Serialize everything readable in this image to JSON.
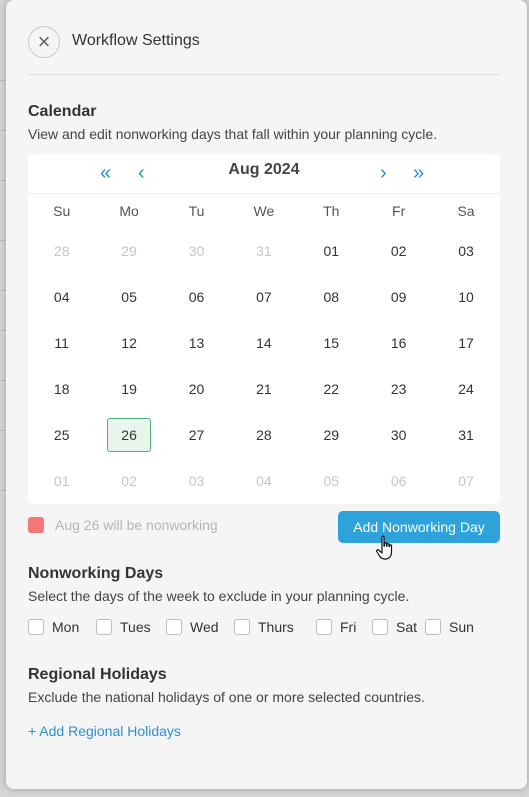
{
  "header": {
    "title": "Workflow Settings",
    "close_icon": "close-icon"
  },
  "calendar_section": {
    "title": "Calendar",
    "description": "View and edit nonworking days that fall within your planning cycle."
  },
  "calendar": {
    "month_label": "Aug 2024",
    "nav": {
      "prev_year": "«",
      "prev_month": "‹",
      "next_month": "›",
      "next_year": "»"
    },
    "weekdays": [
      "Su",
      "Mo",
      "Tu",
      "We",
      "Th",
      "Fr",
      "Sa"
    ],
    "weeks": [
      [
        {
          "d": "28",
          "m": true
        },
        {
          "d": "29",
          "m": true
        },
        {
          "d": "30",
          "m": true
        },
        {
          "d": "31",
          "m": true
        },
        {
          "d": "01"
        },
        {
          "d": "02"
        },
        {
          "d": "03"
        }
      ],
      [
        {
          "d": "04"
        },
        {
          "d": "05"
        },
        {
          "d": "06"
        },
        {
          "d": "07"
        },
        {
          "d": "08"
        },
        {
          "d": "09"
        },
        {
          "d": "10"
        }
      ],
      [
        {
          "d": "11"
        },
        {
          "d": "12"
        },
        {
          "d": "13"
        },
        {
          "d": "14"
        },
        {
          "d": "15"
        },
        {
          "d": "16"
        },
        {
          "d": "17"
        }
      ],
      [
        {
          "d": "18"
        },
        {
          "d": "19"
        },
        {
          "d": "20"
        },
        {
          "d": "21"
        },
        {
          "d": "22"
        },
        {
          "d": "23"
        },
        {
          "d": "24"
        }
      ],
      [
        {
          "d": "25"
        },
        {
          "d": "26",
          "s": true
        },
        {
          "d": "27"
        },
        {
          "d": "28"
        },
        {
          "d": "29"
        },
        {
          "d": "30"
        },
        {
          "d": "31"
        }
      ],
      [
        {
          "d": "01",
          "m": true
        },
        {
          "d": "02",
          "m": true
        },
        {
          "d": "03",
          "m": true
        },
        {
          "d": "04",
          "m": true
        },
        {
          "d": "05",
          "m": true
        },
        {
          "d": "06",
          "m": true
        },
        {
          "d": "07",
          "m": true
        }
      ]
    ],
    "selected_color": "#4caf7a"
  },
  "nonworking_notice": {
    "text": "Aug 26 will be nonworking",
    "swatch_color": "#f4777a"
  },
  "add_nonworking_button": {
    "label": "Add Nonworking Day",
    "color": "#2ea3db"
  },
  "nonworking_days": {
    "title": "Nonworking Days",
    "description": "Select the days of the week to exclude in your planning cycle.",
    "options": [
      "Mon",
      "Tues",
      "Wed",
      "Thurs",
      "Fri",
      "Sat",
      "Sun"
    ]
  },
  "regional_holidays": {
    "title": "Regional Holidays",
    "description": "Exclude the national holidays of one or more selected countries.",
    "add_link": "+ Add Regional Holidays"
  }
}
